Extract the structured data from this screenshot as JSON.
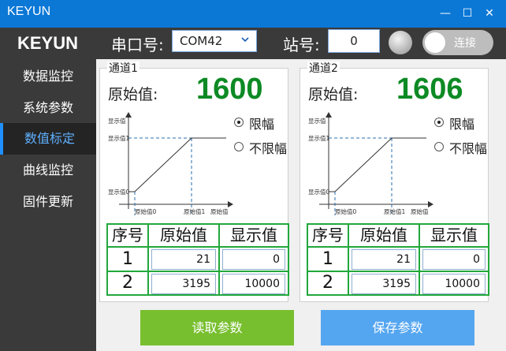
{
  "window": {
    "title": "KEYUN",
    "minimize": "—",
    "maximize": "☐",
    "close": "✕"
  },
  "header": {
    "logo": "KEYUN",
    "port_label": "串口号:",
    "port_value": "COM42",
    "station_label": "站号:",
    "station_value": "0",
    "connect_label": "连接"
  },
  "sidebar": {
    "items": [
      {
        "label": "数据监控"
      },
      {
        "label": "系统参数"
      },
      {
        "label": "数值标定"
      },
      {
        "label": "曲线监控"
      },
      {
        "label": "固件更新"
      }
    ]
  },
  "channels": [
    {
      "title": "通道1",
      "raw_label": "原始值:",
      "raw_value": "1600",
      "diagram": {
        "y_axis": "显示值",
        "y_tick_top": "显示值1",
        "y_tick_bottom": "显示值0",
        "x_tick_left": "原始值0",
        "x_tick_right": "原始值1",
        "x_axis": "原始值"
      },
      "radio_limit": "限幅",
      "radio_nolimit": "不限幅",
      "radio_selected": "限幅",
      "table": {
        "headers": [
          "序号",
          "原始值",
          "显示值"
        ],
        "rows": [
          {
            "idx": "1",
            "raw": "21",
            "display": "0"
          },
          {
            "idx": "2",
            "raw": "3195",
            "display": "10000"
          }
        ]
      }
    },
    {
      "title": "通道2",
      "raw_label": "原始值:",
      "raw_value": "1606",
      "diagram": {
        "y_axis": "显示值",
        "y_tick_top": "显示值1",
        "y_tick_bottom": "显示值0",
        "x_tick_left": "原始值0",
        "x_tick_right": "原始值1",
        "x_axis": "原始值"
      },
      "radio_limit": "限幅",
      "radio_nolimit": "不限幅",
      "radio_selected": "限幅",
      "table": {
        "headers": [
          "序号",
          "原始值",
          "显示值"
        ],
        "rows": [
          {
            "idx": "1",
            "raw": "21",
            "display": "0"
          },
          {
            "idx": "2",
            "raw": "3195",
            "display": "10000"
          }
        ]
      }
    }
  ],
  "actions": {
    "read": "读取参数",
    "save": "保存参数"
  },
  "colors": {
    "titlebar": "#0b78d6",
    "sidebar": "#3a3a3a",
    "active_nav": "#5fb0ff",
    "raw_value": "#0d8a24",
    "table_border": "#22a83c",
    "read_button": "#78bf2f",
    "save_button": "#55a6f0"
  }
}
